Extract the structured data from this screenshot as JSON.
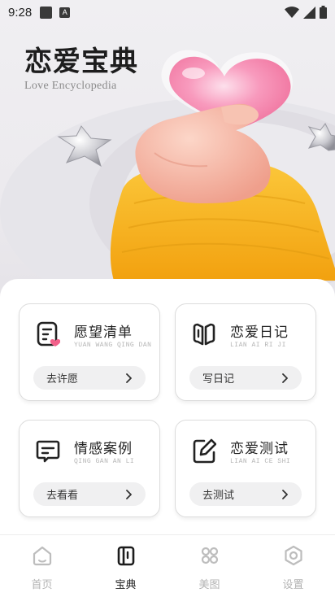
{
  "status_bar": {
    "time": "9:28",
    "ab_glyph": "A"
  },
  "hero": {
    "title": "恋爱宝典",
    "subtitle": "Love Encyclopedia"
  },
  "features": [
    {
      "title": "愿望清单",
      "subtitle": "YUAN WANG QING DAN",
      "button": "去许愿",
      "icon": "checklist-heart-icon"
    },
    {
      "title": "恋爱日记",
      "subtitle": "LIAN AI RI JI",
      "button": "写日记",
      "icon": "open-book-icon"
    },
    {
      "title": "情感案例",
      "subtitle": "QING GAN AN LI",
      "button": "去看看",
      "icon": "chat-bubble-icon"
    },
    {
      "title": "恋爱测试",
      "subtitle": "LIAN AI CE SHI",
      "button": "去测试",
      "icon": "edit-pen-icon"
    }
  ],
  "bottom_nav": [
    {
      "label": "首页",
      "icon": "home-icon",
      "active": false
    },
    {
      "label": "宝典",
      "icon": "book-icon",
      "active": true
    },
    {
      "label": "美图",
      "icon": "grid-icon",
      "active": false
    },
    {
      "label": "设置",
      "icon": "settings-icon",
      "active": false
    }
  ],
  "colors": {
    "heart": "#f78ab0",
    "sweater": "#f7b316",
    "hand": "#f5b6a3",
    "accent_pink": "#f2608a"
  }
}
